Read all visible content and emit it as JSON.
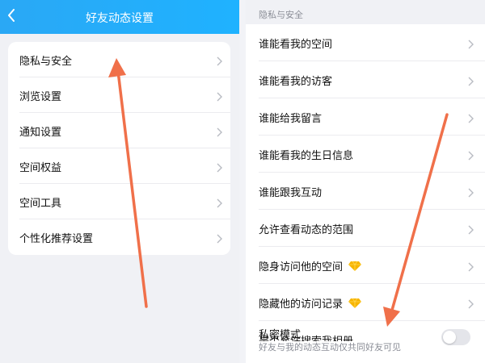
{
  "left": {
    "header": {
      "title": "好友动态设置",
      "back_icon": "back-chevron-icon"
    },
    "items": [
      {
        "label": "隐私与安全"
      },
      {
        "label": "浏览设置"
      },
      {
        "label": "通知设置"
      },
      {
        "label": "空间权益"
      },
      {
        "label": "空间工具"
      },
      {
        "label": "个性化推荐设置"
      }
    ]
  },
  "right": {
    "section_title": "隐私与安全",
    "items": [
      {
        "label": "谁能看我的空间",
        "vip": false
      },
      {
        "label": "谁能看我的访客",
        "vip": false
      },
      {
        "label": "谁能给我留言",
        "vip": false
      },
      {
        "label": "谁能看我的生日信息",
        "vip": false
      },
      {
        "label": "谁能跟我互动",
        "vip": false
      },
      {
        "label": "允许查看动态的范围",
        "vip": false
      },
      {
        "label": "隐身访问他的空间",
        "vip": true
      },
      {
        "label": "隐藏他的访问记录",
        "vip": true
      }
    ],
    "private_mode": {
      "label": "私密模式",
      "description": "好友与我的动态互动仅共同好友可见",
      "enabled": false
    },
    "cutoff_label": "是否允许搜索我相册"
  },
  "colors": {
    "header_bg": "#1fb2ff",
    "arrow": "#f0704a",
    "vip_gold": "#f7b500"
  }
}
